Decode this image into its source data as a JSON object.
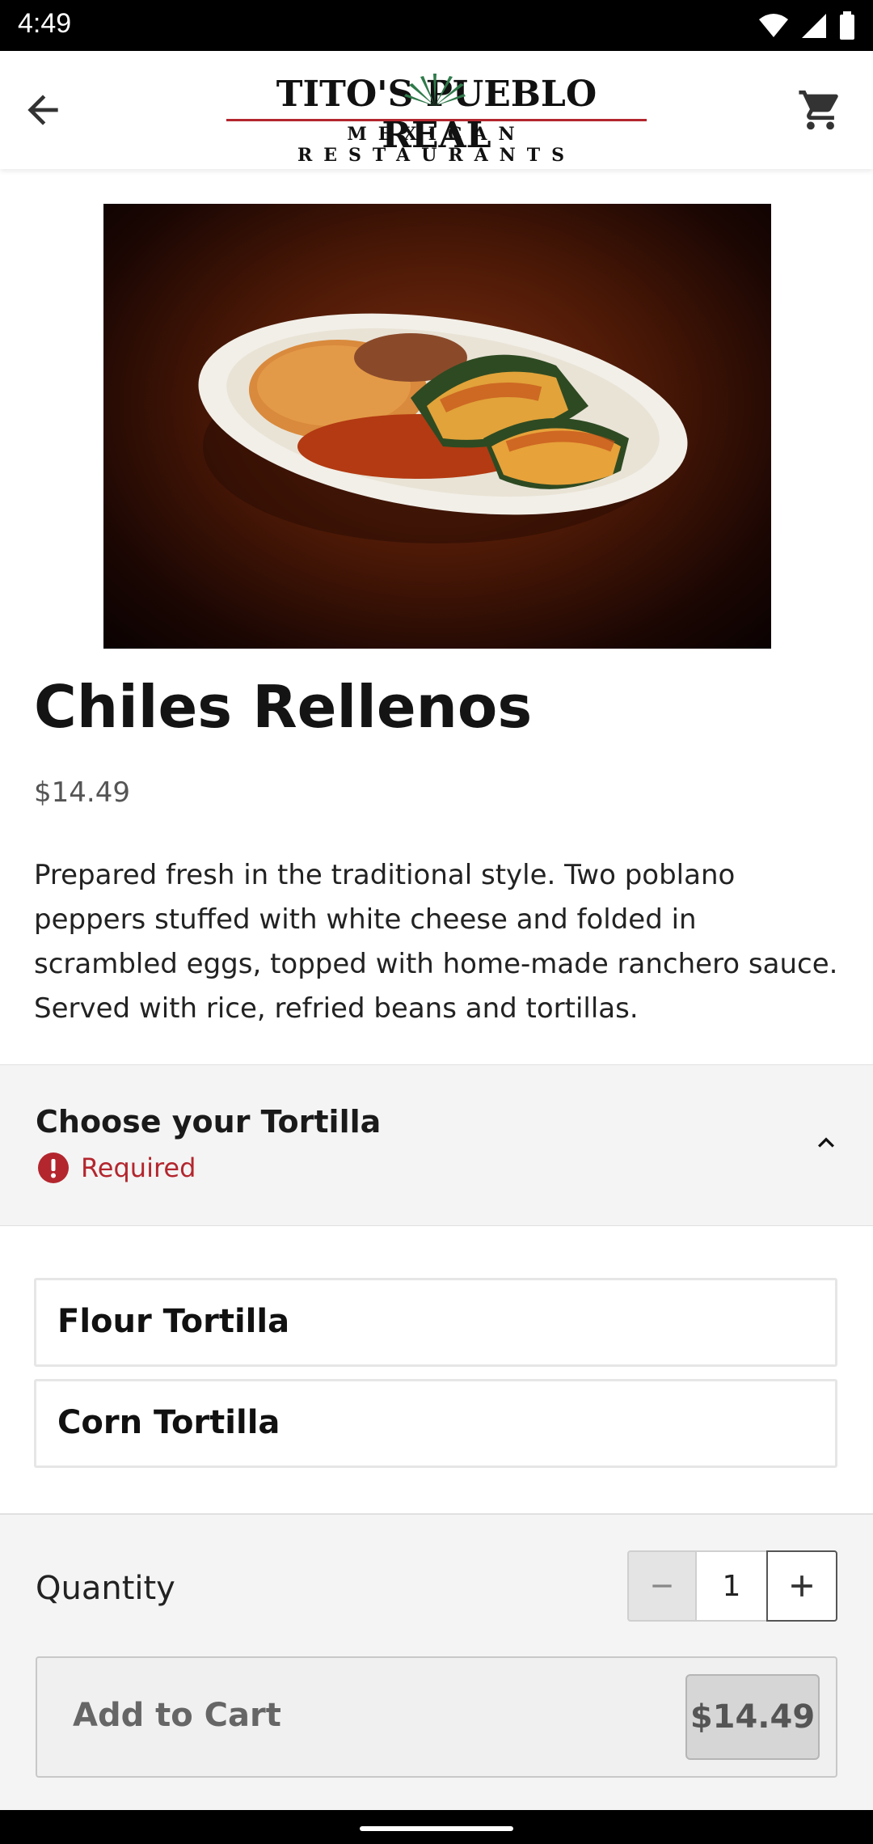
{
  "status_bar": {
    "time": "4:49",
    "icons": [
      "wifi-icon",
      "signal-icon",
      "battery-icon"
    ]
  },
  "app_bar": {
    "back_icon": "arrow-left-icon",
    "cart_icon": "shopping-cart-icon",
    "logo": {
      "main": "TITO'S PUEBLO REAL",
      "sub": "MEXICAN RESTAURANTS"
    }
  },
  "item": {
    "name": "Chiles Rellenos",
    "price": "$14.49",
    "description": "Prepared fresh in the traditional style. Two poblano peppers stuffed with white cheese and folded in scrambled eggs, topped with home-made ranchero sauce. Served with rice, refried beans and tortillas."
  },
  "modifier_group": {
    "title": "Choose your Tortilla",
    "required_label": "Required",
    "collapse_icon": "chevron-up-icon",
    "options": [
      {
        "label": "Flour Tortilla"
      },
      {
        "label": "Corn Tortilla"
      }
    ]
  },
  "order": {
    "quantity_label": "Quantity",
    "quantity": "1",
    "add_to_cart_label": "Add to Cart",
    "total": "$14.49"
  },
  "colors": {
    "accent_red": "#b3262e",
    "panel_bg": "#f4f4f4"
  }
}
